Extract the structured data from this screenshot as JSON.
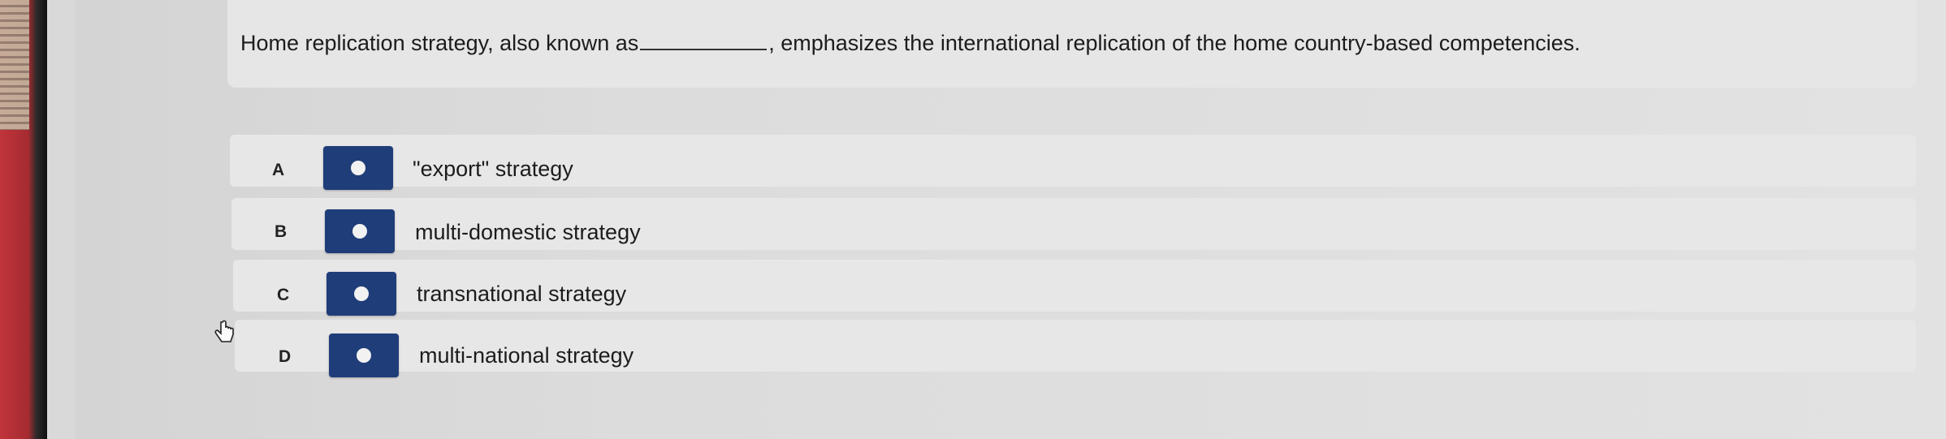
{
  "question": {
    "text_before": "Home replication strategy, also known as",
    "text_after": ", emphasizes the international replication of the home country-based competencies."
  },
  "options": [
    {
      "letter": "A",
      "label": "\"export\" strategy"
    },
    {
      "letter": "B",
      "label": "multi-domestic strategy"
    },
    {
      "letter": "C",
      "label": "transnational strategy"
    },
    {
      "letter": "D",
      "label": "multi-national strategy"
    }
  ],
  "colors": {
    "radio": "#1f3d78",
    "panel": "#e7e7e7"
  }
}
